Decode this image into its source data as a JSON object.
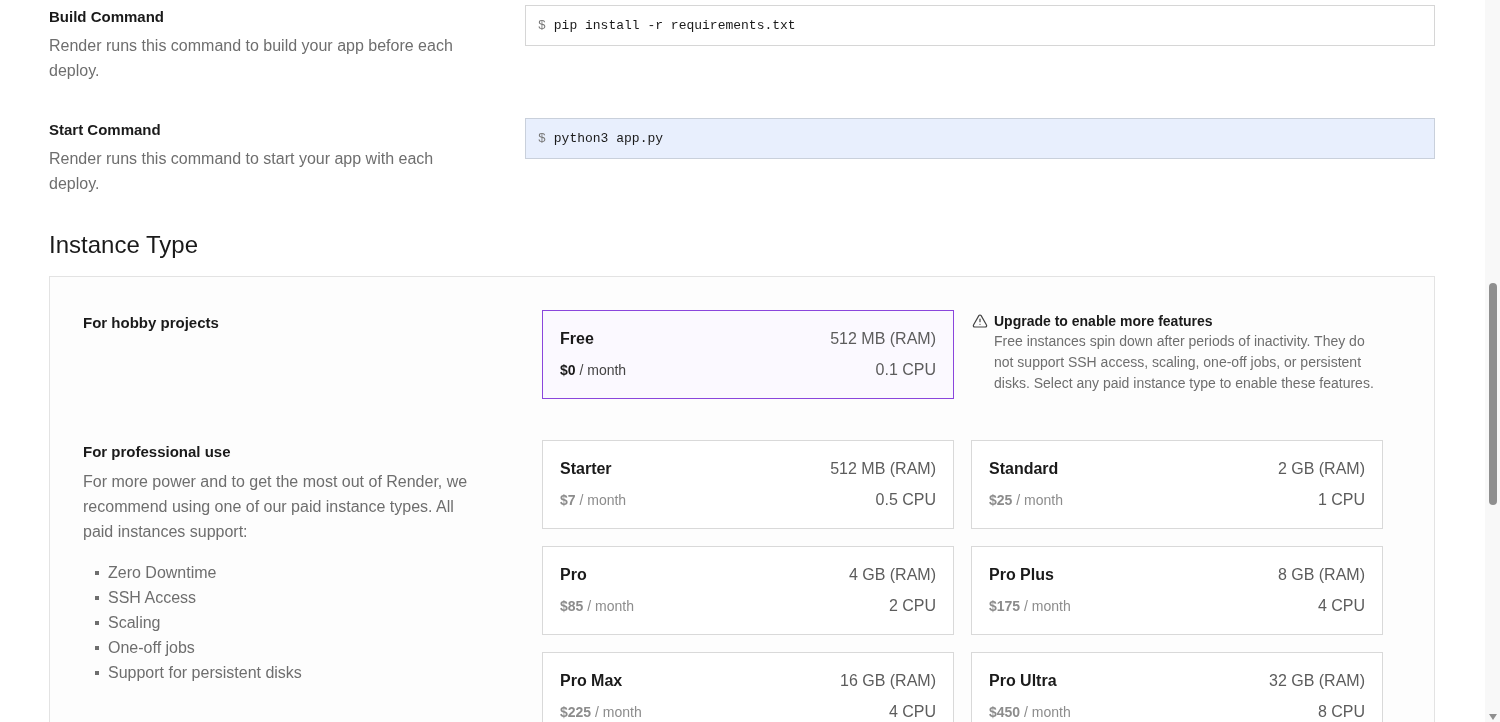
{
  "commands": [
    {
      "label": "Build Command",
      "description": "Render runs this command to build your app before each deploy.",
      "prompt": "$",
      "value": "pip install -r requirements.txt",
      "highlighted": false
    },
    {
      "label": "Start Command",
      "description": "Render runs this command to start your app with each deploy.",
      "prompt": "$",
      "value": "python3 app.py",
      "highlighted": true
    }
  ],
  "instance_type": {
    "title": "Instance Type",
    "hobby": {
      "label": "For hobby projects",
      "plans": [
        {
          "name": "Free",
          "price": "$0",
          "period": "/ month",
          "memory": "512 MB (RAM)",
          "cpu": "0.1 CPU",
          "selected": true
        }
      ],
      "notice": {
        "title": "Upgrade to enable more features",
        "text": "Free instances spin down after periods of inactivity. They do not support SSH access, scaling, one-off jobs, or persistent disks. Select any paid instance type to enable these features."
      }
    },
    "professional": {
      "label": "For professional use",
      "description": "For more power and to get the most out of Render, we recommend using one of our paid instance types. All paid instances support:",
      "features": [
        "Zero Downtime",
        "SSH Access",
        "Scaling",
        "One-off jobs",
        "Support for persistent disks"
      ],
      "plans": [
        {
          "name": "Starter",
          "price": "$7",
          "period": "/ month",
          "memory": "512 MB (RAM)",
          "cpu": "0.5 CPU",
          "selected": false
        },
        {
          "name": "Standard",
          "price": "$25",
          "period": "/ month",
          "memory": "2 GB (RAM)",
          "cpu": "1 CPU",
          "selected": false
        },
        {
          "name": "Pro",
          "price": "$85",
          "period": "/ month",
          "memory": "4 GB (RAM)",
          "cpu": "2 CPU",
          "selected": false
        },
        {
          "name": "Pro Plus",
          "price": "$175",
          "period": "/ month",
          "memory": "8 GB (RAM)",
          "cpu": "4 CPU",
          "selected": false
        },
        {
          "name": "Pro Max",
          "price": "$225",
          "period": "/ month",
          "memory": "16 GB (RAM)",
          "cpu": "4 CPU",
          "selected": false
        },
        {
          "name": "Pro Ultra",
          "price": "$450",
          "period": "/ month",
          "memory": "32 GB (RAM)",
          "cpu": "8 CPU",
          "selected": false
        }
      ]
    }
  }
}
